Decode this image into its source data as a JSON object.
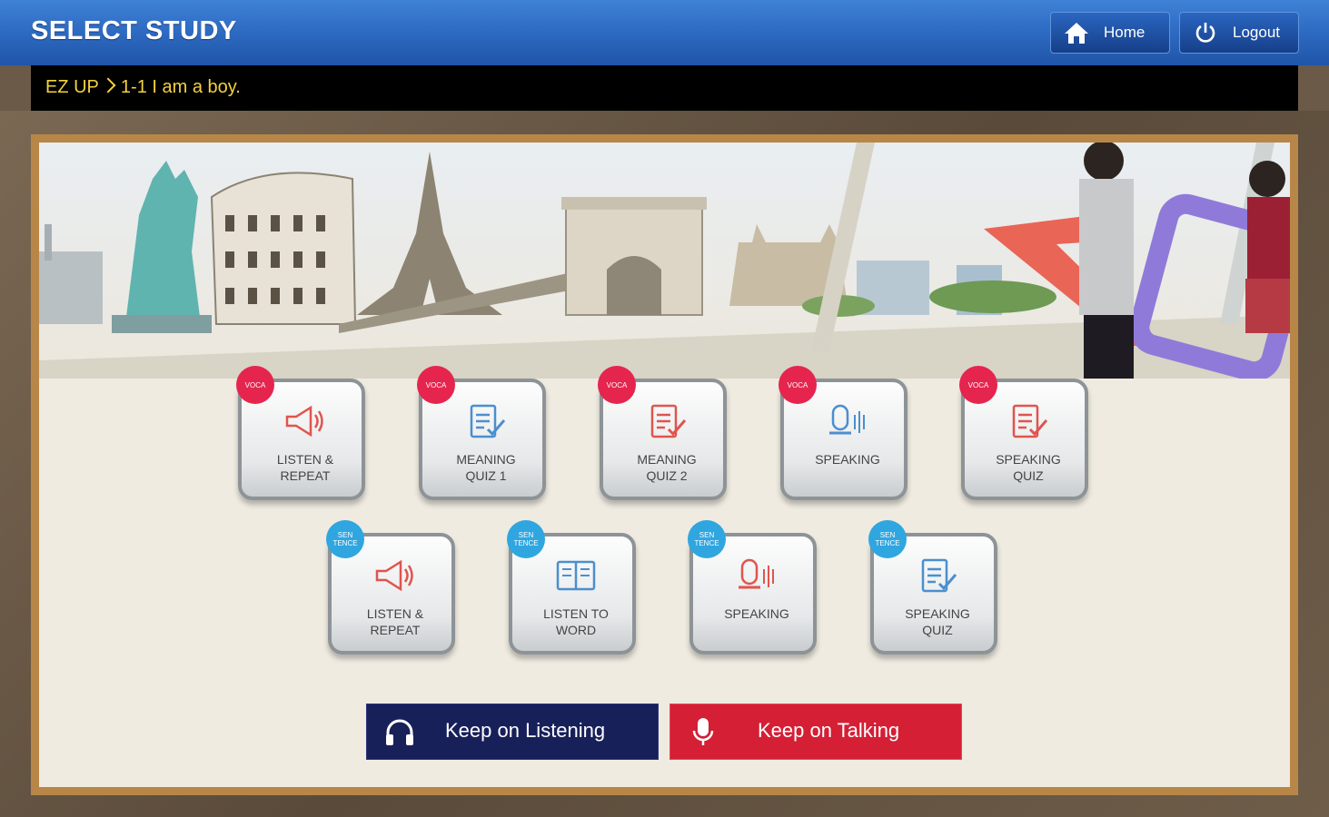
{
  "header": {
    "title": "SELECT STUDY",
    "home_label": "Home",
    "logout_label": "Logout"
  },
  "breadcrumb": {
    "root": "EZ UP",
    "current": "1-1 I am a boy."
  },
  "voca_items": [
    {
      "badge": "VOCA",
      "label": "LISTEN &\nREPEAT",
      "icon": "speaker-icon"
    },
    {
      "badge": "VOCA",
      "label": "MEANING\nQUIZ 1",
      "icon": "quiz-doc-icon"
    },
    {
      "badge": "VOCA",
      "label": "MEANING\nQUIZ 2",
      "icon": "quiz-doc-icon"
    },
    {
      "badge": "VOCA",
      "label": "SPEAKING",
      "icon": "microphone-icon"
    },
    {
      "badge": "VOCA",
      "label": "SPEAKING\nQUIZ",
      "icon": "quiz-doc-icon"
    }
  ],
  "sentence_items": [
    {
      "badge": "SEN\nTENCE",
      "label": "LISTEN &\nREPEAT",
      "icon": "speaker-icon"
    },
    {
      "badge": "SEN\nTENCE",
      "label": "LISTEN TO\nWORD",
      "icon": "book-icon"
    },
    {
      "badge": "SEN\nTENCE",
      "label": "SPEAKING",
      "icon": "microphone-icon"
    },
    {
      "badge": "SEN\nTENCE",
      "label": "SPEAKING\nQUIZ",
      "icon": "quiz-doc-icon"
    }
  ],
  "actions": {
    "listening_label": "Keep on Listening",
    "talking_label": "Keep on Talking"
  },
  "colors": {
    "header_blue": "#2f6cc4",
    "crumb_yellow": "#f4d23c",
    "voca_pink": "#e5254e",
    "sentence_blue": "#2fa6e0",
    "listening_navy": "#18205a",
    "talking_red": "#d41f35",
    "frame_gold": "#b88748"
  }
}
